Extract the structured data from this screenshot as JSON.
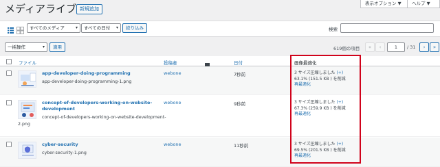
{
  "header": {
    "title": "メディアライブラリ",
    "add_new": "新規追加",
    "screen_options": "表示オプション ▼",
    "help": "ヘルプ ▼"
  },
  "filters": {
    "media_type": "すべてのメディア",
    "date": "すべての日付",
    "filter_button": "絞り込み",
    "search_label": "検索",
    "search_value": ""
  },
  "bulk": {
    "select": "一括操作",
    "apply": "適用"
  },
  "pagination": {
    "items_count": "619個の項目",
    "first": "«",
    "prev": "‹",
    "current_page": "1",
    "total": "/ 31",
    "next": "›",
    "last": "»"
  },
  "table": {
    "columns": {
      "file": "ファイル",
      "author": "投稿者",
      "comments_icon": "comment-bubble-icon",
      "date": "日付",
      "optimize": "画像最適化"
    },
    "rows": [
      {
        "title": "app-developer-doing-programming",
        "filename": "app-developer-doing-programming-1.png",
        "author": "webone",
        "date": "7秒前",
        "status": "3 サイズ圧縮しました",
        "plus": "(+)",
        "saved": "63.1% (151.5 KB ) を削減",
        "reoptimize": "再最適化"
      },
      {
        "title_line1": "concept-of-developers-working-on-website-",
        "title_line2": "development",
        "filename_line1": "concept-of-developers-working-on-website-development-",
        "filename_line2": "2.png",
        "author": "webone",
        "date": "9秒前",
        "status": "3 サイズ圧縮しました",
        "plus": "(+)",
        "saved": "67.3% (259.9 KB ) を削減",
        "reoptimize": "再最適化"
      },
      {
        "title": "cyber-security",
        "filename": "cyber-security-1.png",
        "author": "webone",
        "date": "11秒前",
        "status": "3 サイズ圧縮しました",
        "plus": "(+)",
        "saved": "69.5% (201.5 KB ) を削減",
        "reoptimize": "再最適化"
      }
    ]
  },
  "colors": {
    "link": "#2271b1",
    "highlight": "#d0021b",
    "background": "#f0f0f1"
  }
}
